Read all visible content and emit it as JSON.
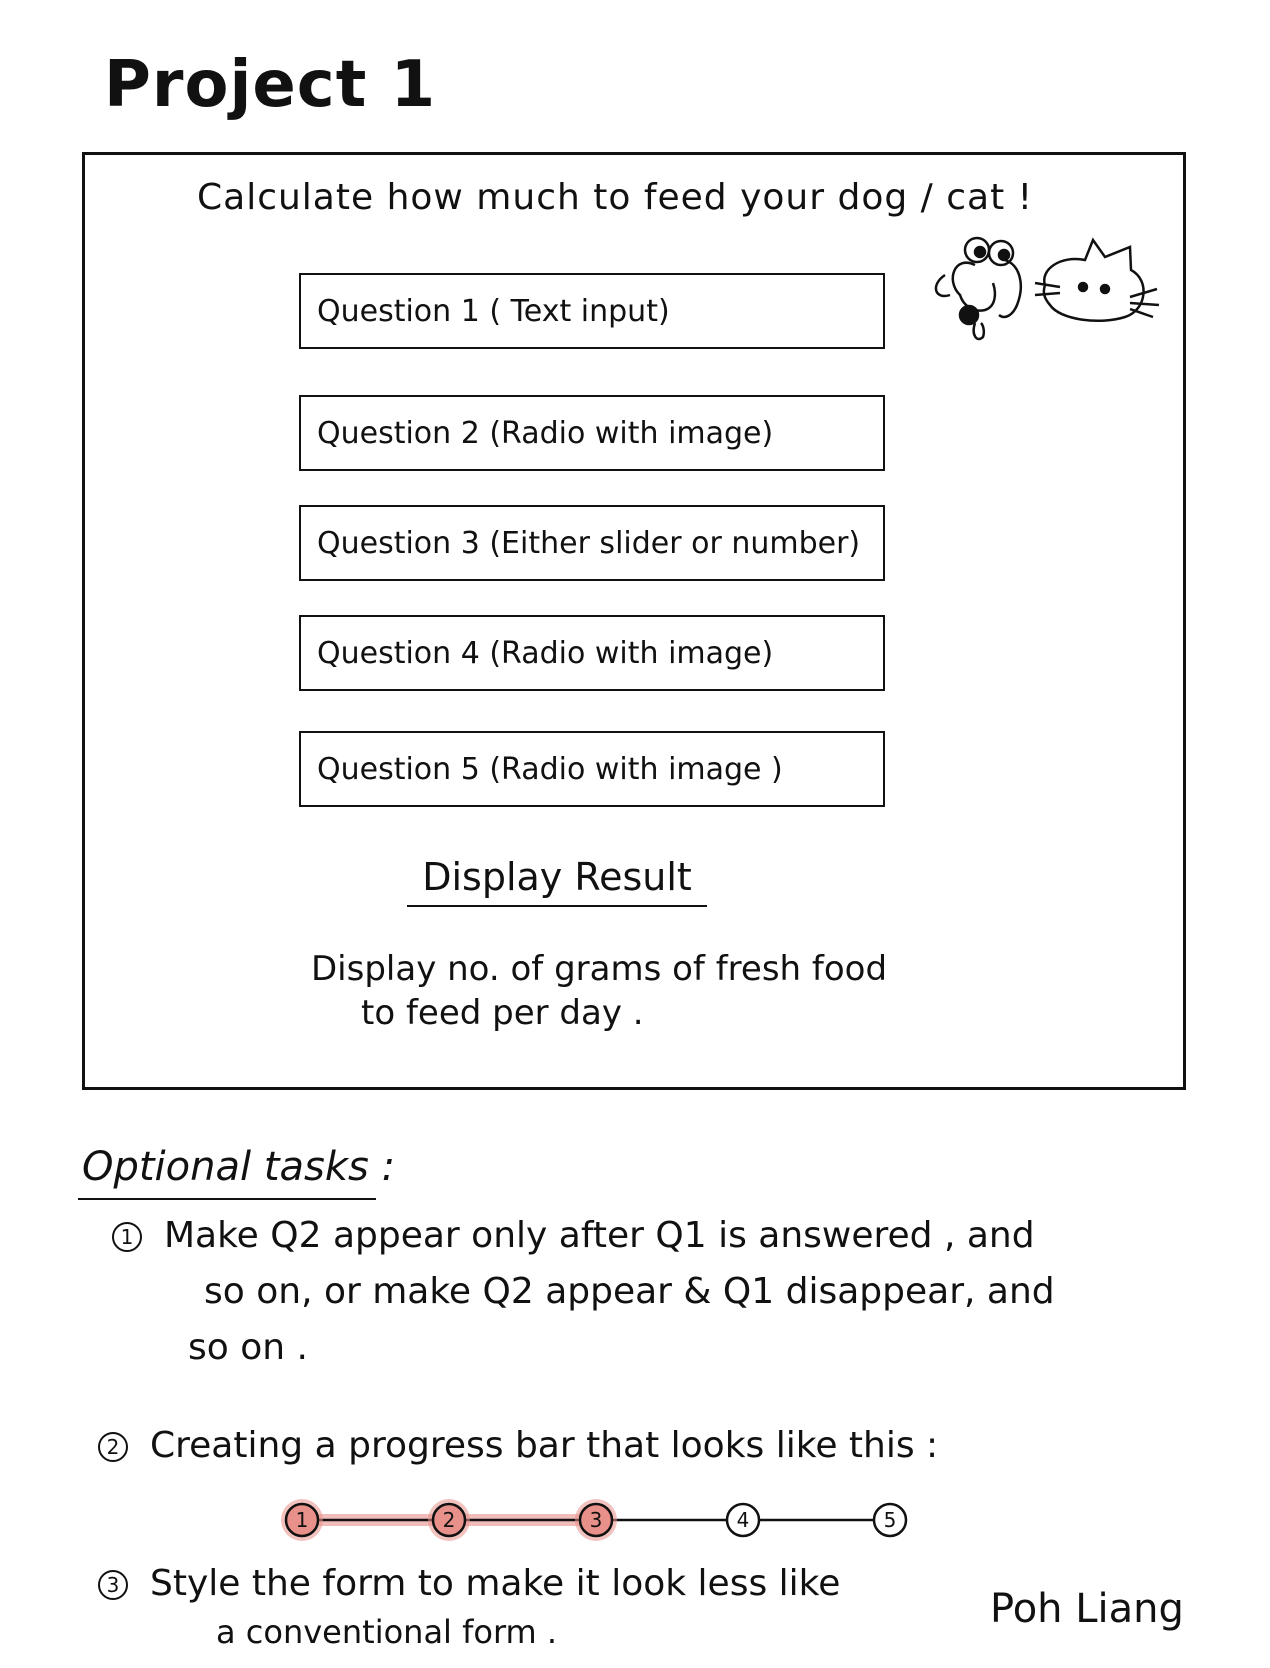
{
  "title": "Project 1",
  "mockup": {
    "heading": "Calculate how much to feed your dog / cat !",
    "questions": [
      "Question 1 ( Text input)",
      "Question 2 (Radio with image)",
      "Question 3 (Either slider or number)",
      "Question 4 (Radio with image)",
      "Question 5 (Radio with image )"
    ],
    "result_heading": "Display Result",
    "result_text_line1": "Display no. of grams of fresh food",
    "result_text_line2": "to feed per day ."
  },
  "optional": {
    "heading": "Optional tasks :",
    "task1_line1": "Make Q2 appear only after Q1 is answered , and",
    "task1_line2": "so on, or make Q2 appear & Q1 disappear, and",
    "task1_line3": "so on .",
    "task2": "Creating a progress bar that looks like this :",
    "progress_steps": [
      "1",
      "2",
      "3",
      "4",
      "5"
    ],
    "progress_completed": 3,
    "progress_color": "#e8908a",
    "task3_line1": "Style the form to make it look less like",
    "task3_line2": "a conventional form ."
  },
  "task_numbers": [
    "1",
    "2",
    "3"
  ],
  "author": "Poh Liang",
  "icons": [
    "dog-sketch-icon",
    "cat-sketch-icon"
  ]
}
